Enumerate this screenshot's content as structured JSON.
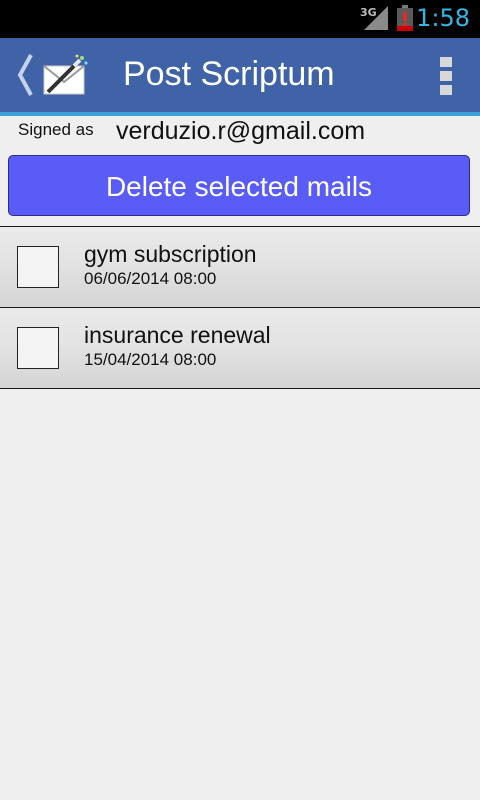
{
  "status_bar": {
    "network": "3G",
    "time": "1:58"
  },
  "action_bar": {
    "title": "Post Scriptum",
    "icons": [
      "back-chevron-icon",
      "envelope-wand-icon",
      "overflow-menu-icon"
    ]
  },
  "account": {
    "signed_label": "Signed as",
    "email": "verduzio.r@gmail.com"
  },
  "delete_button": {
    "label": "Delete selected mails",
    "color": "#5a5cf7"
  },
  "mails": [
    {
      "subject": "gym subscription",
      "date": "06/06/2014 08:00",
      "checked": false
    },
    {
      "subject": "insurance renewal",
      "date": "15/04/2014 08:00",
      "checked": false
    }
  ],
  "colors": {
    "action_bar": "#3f63a6",
    "action_bar_accent": "#3aa0d8",
    "clock": "#33b5e5"
  }
}
